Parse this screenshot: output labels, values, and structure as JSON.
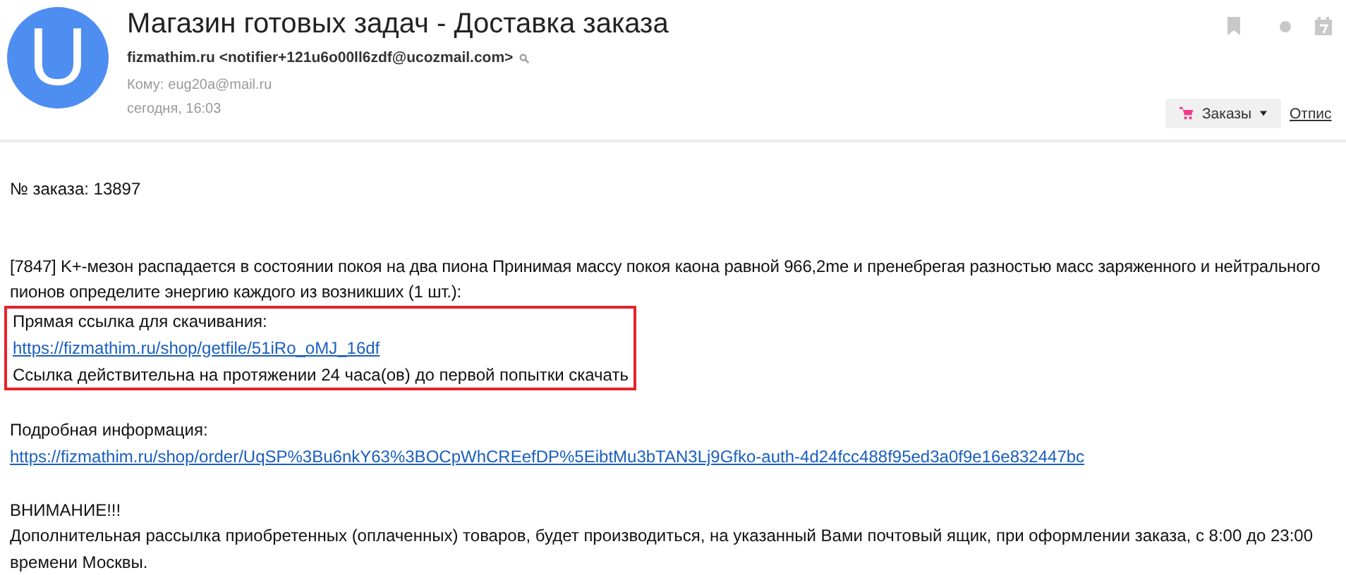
{
  "header": {
    "avatar_letter": "U",
    "subject": "Магазин готовых задач - Доставка заказа",
    "sender": "fizmathim.ru <notifier+121u6o00ll6zdf@ucozmail.com>",
    "to_label": "Кому:",
    "to": "eug20a@mail.ru",
    "date": "сегодня, 16:03",
    "orders_button": "Заказы",
    "unsubscribe_link": "Отпис"
  },
  "body": {
    "order_number": "№ заказа: 13897",
    "item": "[7847] K+-мезон распадается в состоянии покоя на два пиона Принимая массу покоя каона равной 966,2me и пренебрегая разностью масс заряженного и нейтрального пионов определите энергию каждого из возникших (1 шт.):",
    "download": {
      "highlighted": true,
      "label": "Прямая ссылка для скачивания:",
      "link": "https://fizmathim.ru/shop/getfile/51iRo_oMJ_16df",
      "note": "Ссылка действительна на протяжении 24 часа(ов) до первой попытки скачать"
    },
    "details_label": "Подробная информация:",
    "details_link": "https://fizmathim.ru/shop/order/UqSP%3Bu6nkY63%3BOCpWhCREefDP%5EibtMu3bTAN3Lj9Gfko-auth-4d24fcc488f95ed3a0f9e16e832447bc",
    "warning_title": "ВНИМАНИЕ!!!",
    "warning_text": "Дополнительная рассылка приобретенных (оплаченных) товаров, будет производиться, на указанный Вами почтовый ящик, при оформлении заказа, с 8:00 до 23:00 времени Москвы."
  }
}
